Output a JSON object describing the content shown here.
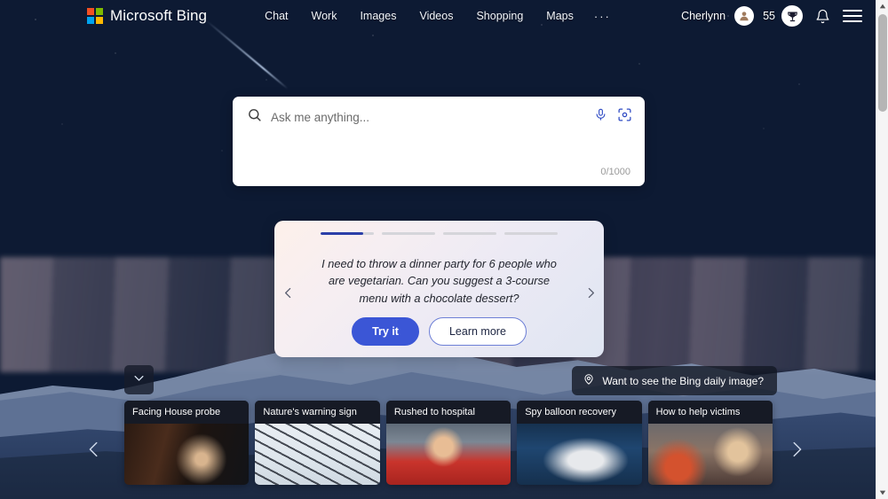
{
  "header": {
    "brand": "Microsoft Bing",
    "logo_icon": "microsoft-logo-icon",
    "nav": [
      {
        "label": "Chat"
      },
      {
        "label": "Work"
      },
      {
        "label": "Images"
      },
      {
        "label": "Videos"
      },
      {
        "label": "Shopping"
      },
      {
        "label": "Maps"
      },
      {
        "label": "···"
      }
    ],
    "user_name": "Cherlynn",
    "avatar_icon": "person-avatar-icon",
    "rewards_count": "55",
    "rewards_icon": "trophy-icon",
    "notifications_icon": "bell-icon",
    "menu_icon": "hamburger-menu-icon"
  },
  "search": {
    "placeholder": "Ask me anything...",
    "value": "",
    "search_icon": "search-icon",
    "mic_icon": "microphone-icon",
    "visual_icon": "visual-search-camera-icon",
    "char_count": "0/1000"
  },
  "suggestion": {
    "progress": [
      {
        "fill_percent": 80
      },
      {
        "fill_percent": 0
      },
      {
        "fill_percent": 0
      },
      {
        "fill_percent": 0
      }
    ],
    "prev_icon": "chevron-left-icon",
    "next_icon": "chevron-right-icon",
    "text": "I need to throw a dinner party for 6 people who are vegetarian. Can you suggest a 3-course menu with a chocolate dessert?",
    "try_label": "Try it",
    "learn_label": "Learn more",
    "primary_color": "#3b56d6",
    "progress_fill_color": "#2b3fa8"
  },
  "daily_image": {
    "label": "Want to see the Bing daily image?",
    "pin_icon": "location-pin-icon"
  },
  "expand": {
    "icon": "chevron-down-icon"
  },
  "news": {
    "prev_icon": "chevron-left-icon",
    "next_icon": "chevron-right-icon",
    "cards": [
      {
        "title": "Facing House probe",
        "thumb_class": "thumb-1"
      },
      {
        "title": "Nature's warning sign",
        "thumb_class": "thumb-2"
      },
      {
        "title": "Rushed to hospital",
        "thumb_class": "thumb-3"
      },
      {
        "title": "Spy balloon recovery",
        "thumb_class": "thumb-4"
      },
      {
        "title": "How to help victims",
        "thumb_class": "thumb-5"
      }
    ]
  },
  "scrollbar": {
    "up_icon": "scroll-up-arrow-icon",
    "down_icon": "scroll-down-arrow-icon"
  }
}
